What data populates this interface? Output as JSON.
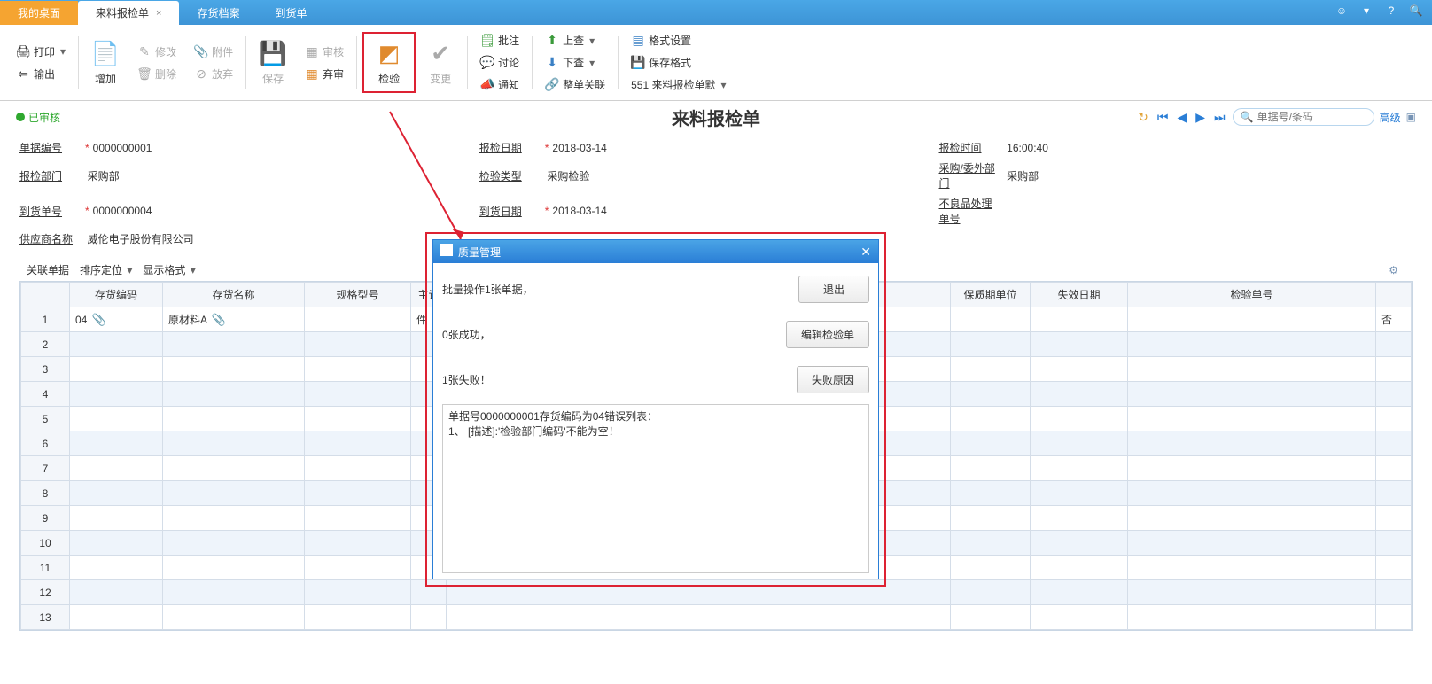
{
  "tabs": {
    "desktop": "我的桌面",
    "active": "来料报检单",
    "t3": "存货档案",
    "t4": "到货单"
  },
  "ribbon": {
    "print": "打印",
    "export": "输出",
    "add": "增加",
    "modify": "修改",
    "delete": "删除",
    "attach": "附件",
    "discard": "放弃",
    "save": "保存",
    "audit": "审核",
    "abandon": "弃审",
    "inspect": "检验",
    "change": "变更",
    "approve": "批注",
    "discuss": "讨论",
    "notify": "通知",
    "up": "上查",
    "down": "下查",
    "rel": "整单关联",
    "fmt": "格式设置",
    "savefmt": "保存格式",
    "tpl": "551 来料报检单默"
  },
  "status": "已审核",
  "page_title": "来料报检单",
  "search_placeholder": "单据号/条码",
  "adv": "高级",
  "form": {
    "l1a": "单据编号",
    "v1a": "0000000001",
    "l1b": "报检日期",
    "v1b": "2018-03-14",
    "l1c": "报检时间",
    "v1c": "16:00:40",
    "l2a": "报检部门",
    "v2a": "采购部",
    "l2b": "检验类型",
    "v2b": "采购检验",
    "l2c": "采购/委外部门",
    "v2c": "采购部",
    "l3a": "到货单号",
    "v3a": "0000000004",
    "l3b": "到货日期",
    "v3b": "2018-03-14",
    "l3c": "不良品处理单号",
    "v3c": "",
    "l4a": "供应商名称",
    "v4a": "威伦电子股份有限公司"
  },
  "grid_toolbar": {
    "rel": "关联单据",
    "sort": "排序定位",
    "disp": "显示格式"
  },
  "cols": {
    "c1": "存货编码",
    "c2": "存货名称",
    "c3": "规格型号",
    "c4": "主计",
    "c5": "保质期单位",
    "c6": "失效日期",
    "c7": "检验单号"
  },
  "row1": {
    "code": "04",
    "name": "原材料A",
    "unit": "件",
    "flag": "否"
  },
  "dialog": {
    "title": "质量管理",
    "line1": "批量操作1张单据，",
    "line2": "0张成功，",
    "line3": "1张失败！",
    "btn1": "退出",
    "btn2": "编辑检验单",
    "btn3": "失败原因",
    "err": "单据号0000000001存货编码为04错误列表：\n1、 [描述]:'检验部门编码'不能为空！"
  }
}
